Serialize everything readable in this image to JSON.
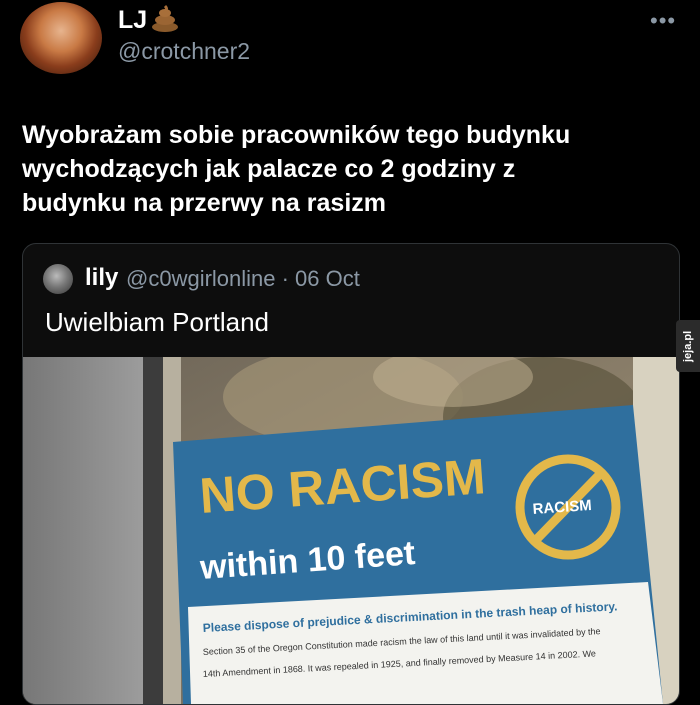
{
  "author": {
    "display_name": "LJ",
    "handle": "@crotchner2",
    "badge_icon": "poop-icon"
  },
  "tweet": {
    "text_line1": "Wyobrażam sobie pracowników tego budynku",
    "text_line2": "wychodzących jak palacze co 2 godziny z",
    "text_line3": "budynku na przerwy na rasizm"
  },
  "quote": {
    "name": "lily",
    "handle_date": "@c0wgirlonline · 06 Oct",
    "text": "Uwielbiam Portland"
  },
  "sign": {
    "headline": "NO RACISM",
    "subhead": "within 10 feet",
    "badge": "RACISM",
    "line1": "Please dispose of prejudice & discrimination in the trash heap of history.",
    "line2": "Section 35 of the Oregon Constitution made racism the law of this land until it was invalidated by the",
    "line3": "14th Amendment in 1868. It was repealed in 1925, and finally removed by Measure 14 in 2002. We"
  },
  "watermark": "jeja.pl",
  "colors": {
    "background": "#000000",
    "sign_blue": "#2f6f9e",
    "sign_gold": "#e3b84a",
    "muted_text": "#8b98a5"
  }
}
